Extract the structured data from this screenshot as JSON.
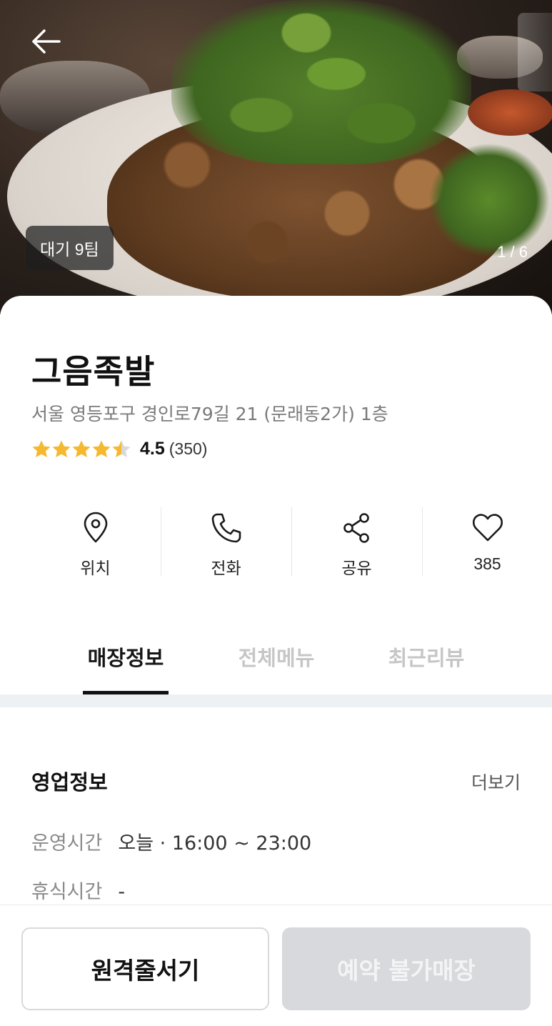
{
  "hero": {
    "wait_badge": "대기 9팀",
    "photo_counter": "1 / 6"
  },
  "store": {
    "name": "그음족발",
    "address": "서울 영등포구 경인로79길 21 (문래동2가) 1층",
    "rating_value": "4.5",
    "rating_count": "(350)",
    "rating_stars": 4.5,
    "star_color": "#f5b82e",
    "star_empty_color": "#d9d9d9"
  },
  "actions": [
    {
      "label": "위치",
      "icon": "map-pin-icon"
    },
    {
      "label": "전화",
      "icon": "phone-icon"
    },
    {
      "label": "공유",
      "icon": "share-icon"
    },
    {
      "label": "385",
      "icon": "heart-icon"
    }
  ],
  "tabs": [
    {
      "label": "매장정보",
      "active": true
    },
    {
      "label": "전체메뉴",
      "active": false
    },
    {
      "label": "최근리뷰",
      "active": false
    }
  ],
  "business_info": {
    "title": "영업정보",
    "more": "더보기",
    "hours_key": "운영시간",
    "hours_value": "오늘 · 16:00 ~ 23:00",
    "break_key": "휴식시간",
    "break_value": "-"
  },
  "bottom": {
    "queue_button": "원격줄서기",
    "reserve_button": "예약 불가매장"
  }
}
